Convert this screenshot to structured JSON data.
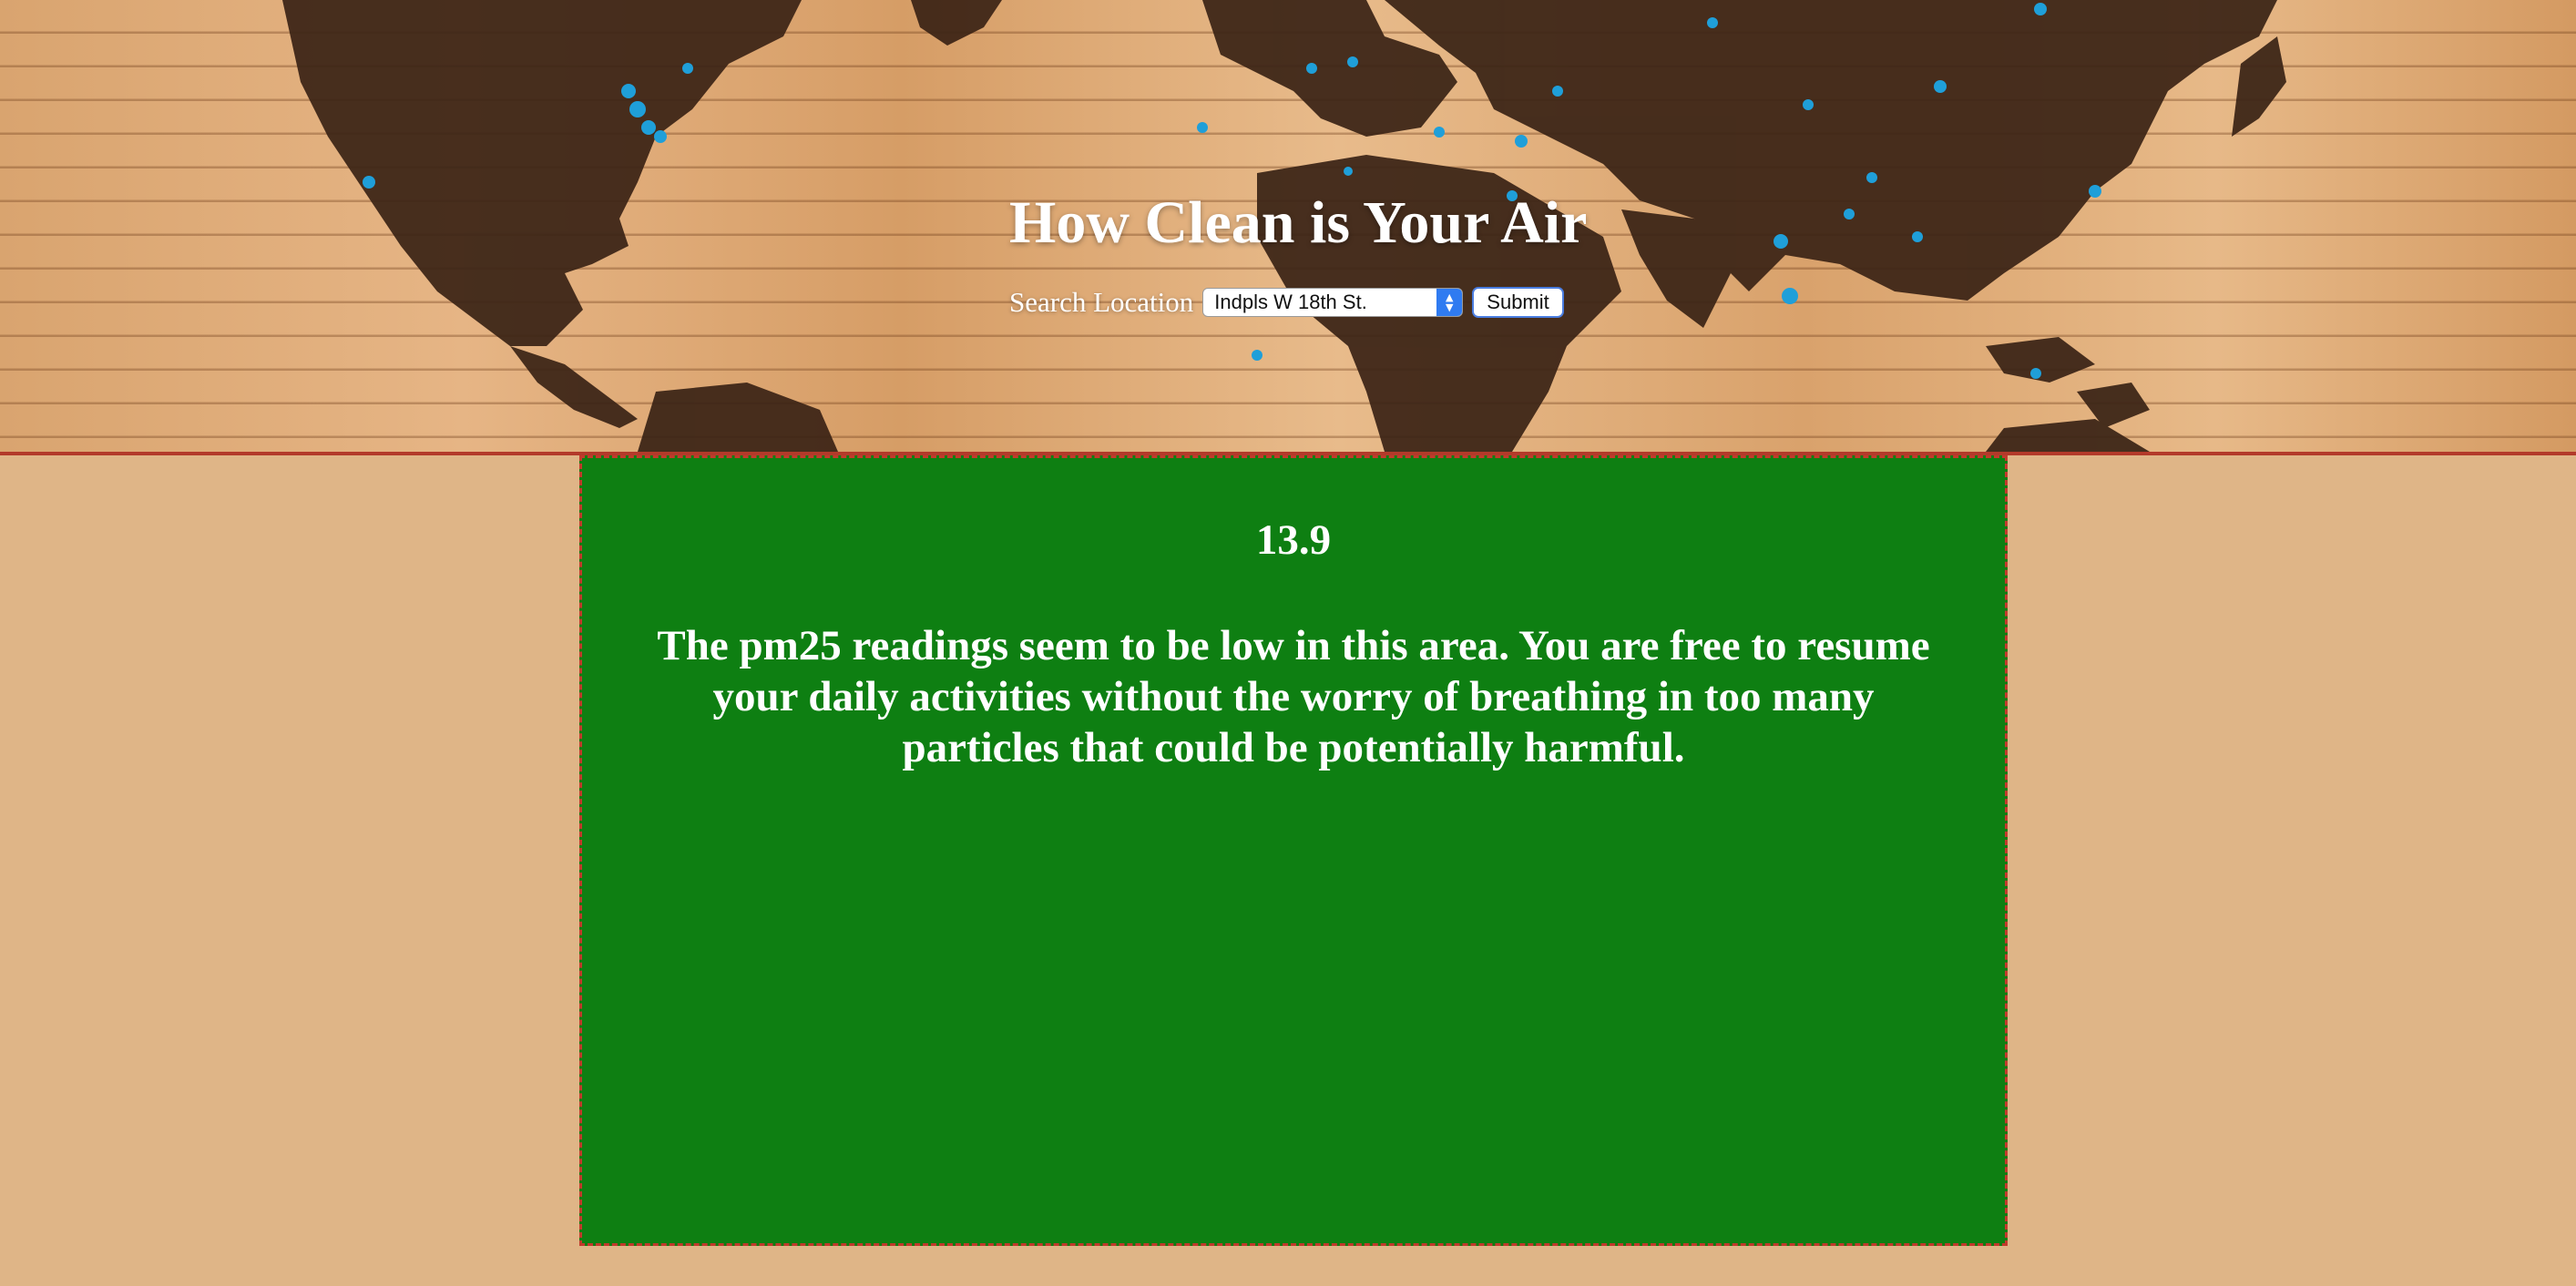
{
  "header": {
    "title": "How Clean is Your Air",
    "search_label": "Search Location",
    "location_select": {
      "selected": "Indpls W 18th St."
    },
    "submit_label": "Submit",
    "background_image": "world-map-on-wooden-planks-with-blue-pins"
  },
  "result": {
    "value": "13.9",
    "message": "The pm25 readings seem to be low in this area. You are free to resume your daily activities without the worry of breathing in too many particles that could be potentially harmful.",
    "panel_color": "#0e7f12",
    "border_color": "#c23a2c"
  },
  "page": {
    "background_color": "#dfb587"
  },
  "icons": {
    "select_arrows": "select-up-down-arrows-icon"
  }
}
